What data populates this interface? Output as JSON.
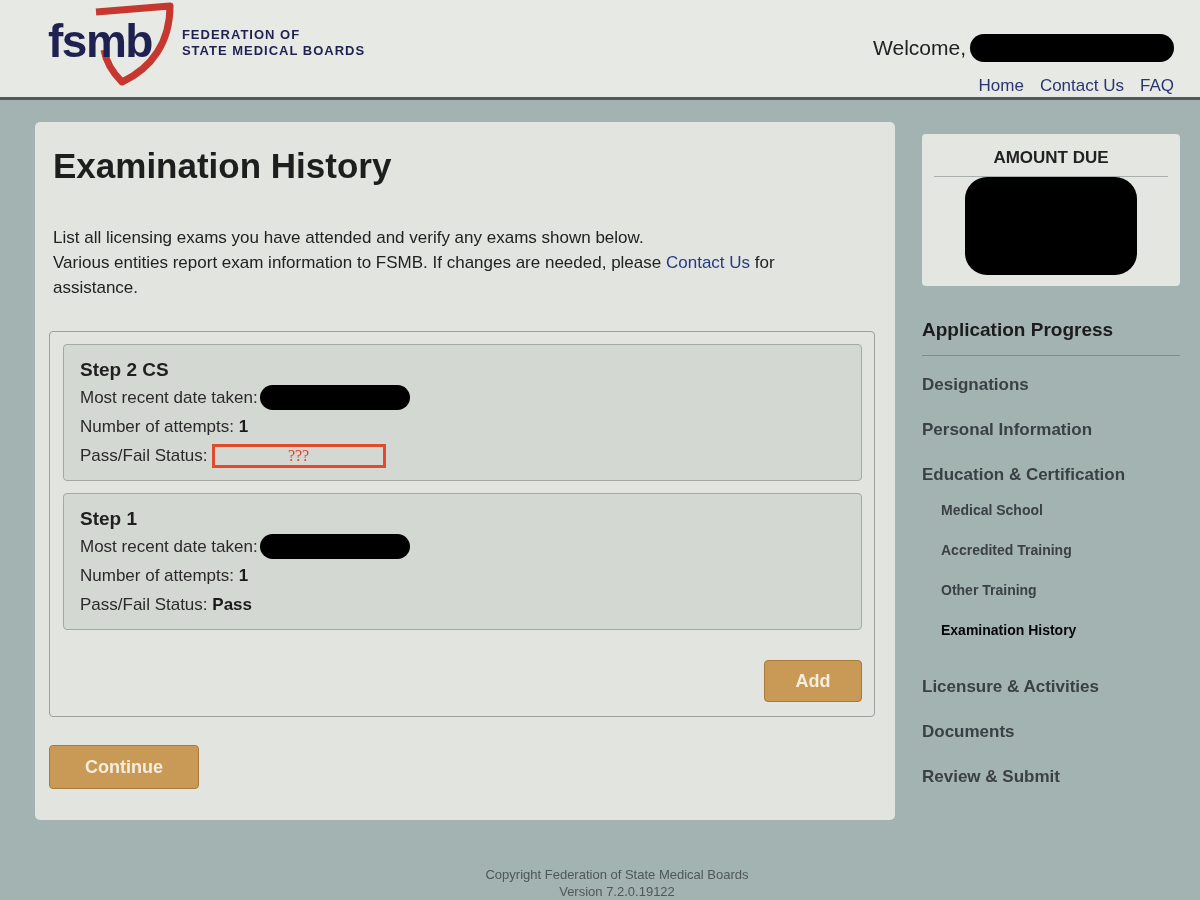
{
  "header": {
    "logo": {
      "mark": "fsmb",
      "name_lines": [
        "FEDERATION OF",
        "STATE MEDICAL BOARDS"
      ]
    },
    "welcome": {
      "label": "Welcome,",
      "redacted": true
    },
    "nav_links": [
      "Home",
      "Contact Us",
      "FAQ"
    ]
  },
  "main": {
    "title": "Examination History",
    "intro": {
      "first": "List all licensing exams you have attended and verify any exams shown below.",
      "before_link": "Various entities report exam information to FSMB. If changes are needed, please",
      "link": "Contact Us",
      "after_link": "for assistance."
    },
    "exams": [
      {
        "title": "Step 2 CS",
        "fields": [
          {
            "kind": "redacted",
            "label": "Most recent date taken:"
          },
          {
            "kind": "value",
            "label": "Number of attempts:",
            "value": "1"
          },
          {
            "kind": "annotation",
            "label": "Pass/Fail Status:",
            "value": "???"
          }
        ]
      },
      {
        "title": "Step 1",
        "fields": [
          {
            "kind": "redacted",
            "label": "Most recent date taken:"
          },
          {
            "kind": "value",
            "label": "Number of attempts:",
            "value": "1"
          },
          {
            "kind": "value",
            "label": "Pass/Fail Status:",
            "value": "Pass"
          }
        ]
      }
    ],
    "add_button": "Add",
    "continue_button": "Continue"
  },
  "sidebar": {
    "amount_due": {
      "title": "AMOUNT DUE",
      "redacted": true
    },
    "progress_title": "Application Progress",
    "items": [
      {
        "label": "Designations",
        "selected": false
      },
      {
        "label": "Personal Information",
        "selected": false
      },
      {
        "label": "Education & Certification",
        "selected": false,
        "children": [
          {
            "label": "Medical School",
            "selected": false
          },
          {
            "label": "Accredited Training",
            "selected": false
          },
          {
            "label": "Other Training",
            "selected": false
          },
          {
            "label": "Examination History",
            "selected": true
          }
        ]
      },
      {
        "label": "Licensure & Activities",
        "selected": false
      },
      {
        "label": "Documents",
        "selected": false
      },
      {
        "label": "Review & Submit",
        "selected": false
      }
    ]
  },
  "footer": [
    "Copyright Federation of State Medical Boards",
    "Version 7.2.0.19122"
  ]
}
